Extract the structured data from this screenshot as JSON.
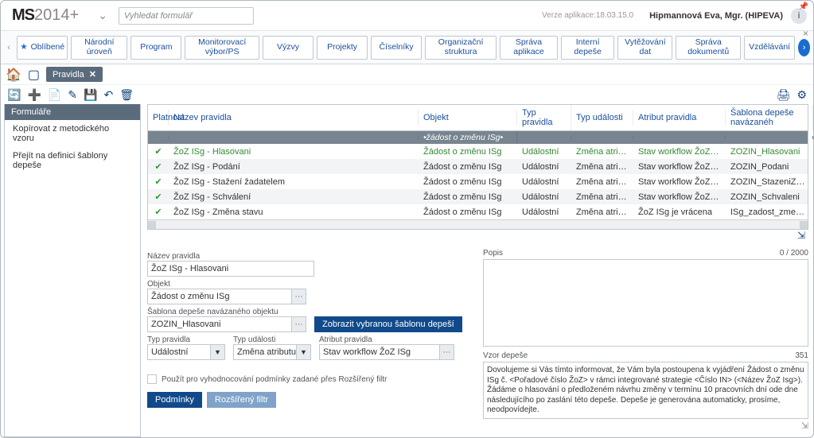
{
  "app": {
    "logo_ms": "MS",
    "logo_year": "2014",
    "logo_plus": "+",
    "search_placeholder": "Vyhledat formulář",
    "version_label": "Verze aplikace:",
    "version_value": "18.03.15.0",
    "user": "Hipmannová Eva, Mgr. (HIPEVA)"
  },
  "ribbon": {
    "favorites": "Oblíbené",
    "tabs": [
      "Národní úroveň",
      "Program",
      "Monitorovací výbor/PS",
      "Výzvy",
      "Projekty",
      "Číselníky",
      "Organizační struktura",
      "Správa aplikace",
      "Interní depeše",
      "Vytěžování dat",
      "Správa dokumentů",
      "Vzdělávání"
    ]
  },
  "crumb": {
    "tab": "Pravidla"
  },
  "sidebar": {
    "header": "Formuláře",
    "items": [
      "Kopírovat z metodického vzoru",
      "Přejít na definici šablony depeše"
    ]
  },
  "grid": {
    "headers": {
      "platnost": "Platnost",
      "nazev": "Název pravidla",
      "objekt": "Objekt",
      "typ_pravidla": "Typ pravidla",
      "typ_udalosti": "Typ události",
      "atribut": "Atribut pravidla",
      "sablona": "Šablona depeše navázanéh"
    },
    "filter": {
      "objekt": "•žádost o změnu ISg•"
    },
    "rows": [
      {
        "nazev": "ŽoZ ISg - Hlasovani",
        "objekt": "Žádost o změnu ISg",
        "typp": "Událostní",
        "typu": "Změna atributu",
        "atr": "Stav workflow ŽoZ ISg",
        "sab": "ZOZIN_Hlasovani",
        "selected": true
      },
      {
        "nazev": "ŽoZ ISg - Podání",
        "objekt": "Žádost o změnu ISg",
        "typp": "Událostní",
        "typu": "Změna atributu",
        "atr": "Stav workflow ŽoZ ISg",
        "sab": "ZOZIN_Podani"
      },
      {
        "nazev": "ŽoZ ISg - Stažení žadatelem",
        "objekt": "Žádost o změnu ISg",
        "typp": "Událostní",
        "typu": "Změna atributu",
        "atr": "Stav workflow ŽoZ ISg",
        "sab": "ZOZIN_StazeniZadatelem"
      },
      {
        "nazev": "ŽoZ ISg - Schválení",
        "objekt": "Žádost o změnu ISg",
        "typp": "Událostní",
        "typu": "Změna atributu",
        "atr": "Stav workflow ŽoZ ISg",
        "sab": "ZOZIN_Schvaleni"
      },
      {
        "nazev": "ŽoZ ISg - Změna stavu",
        "objekt": "Žádost o změnu ISg",
        "typp": "Událostní",
        "typu": "Změna atributu",
        "atr": "ŽoZ ISg je vrácena",
        "sab": "ISg_zadost_zmena_stavu"
      }
    ]
  },
  "form": {
    "nazev_label": "Název pravidla",
    "nazev_value": "ŽoZ ISg - Hlasovani",
    "objekt_label": "Objekt",
    "objekt_value": "Žádost o změnu ISg",
    "sablona_label": "Šablona depeše navázaného objektu",
    "sablona_value": "ZOZIN_Hlasovani",
    "typ_pravidla_label": "Typ pravidla",
    "typ_pravidla_value": "Událostní",
    "typ_udalosti_label": "Typ události",
    "typ_udalosti_value": "Změna atributu",
    "atribut_label": "Atribut pravidla",
    "atribut_value": "Stav workflow ŽoZ ISg",
    "zobrazit_btn": "Zobrazit vybranou šablonu depeší",
    "popis_label": "Popis",
    "popis_counter": "0 / 2000",
    "vzor_label": "Vzor depeše",
    "vzor_counter": "351",
    "vzor_text": "Dovolujeme si Vás tímto informovat, že Vám byla postoupena k vyjádření Žádost o změnu ISg č. <Pořadové číslo ŽoZ> v rámci integrované strategie <Číslo IN> (<Název ŽoZ Isg>). Žádáme o hlasování o předloženém návrhu změny v termínu 10 pracovních dní ode dne následujícího po zaslání této depeše. Depeše je generována automaticky, prosíme, neodpovídejte.",
    "chk_label": "Použít pro vyhodnocování podmínky zadané přes Rozšířený filtr",
    "podminky_btn": "Podmínky",
    "rozsireny_btn": "Rozšířený filtr"
  }
}
